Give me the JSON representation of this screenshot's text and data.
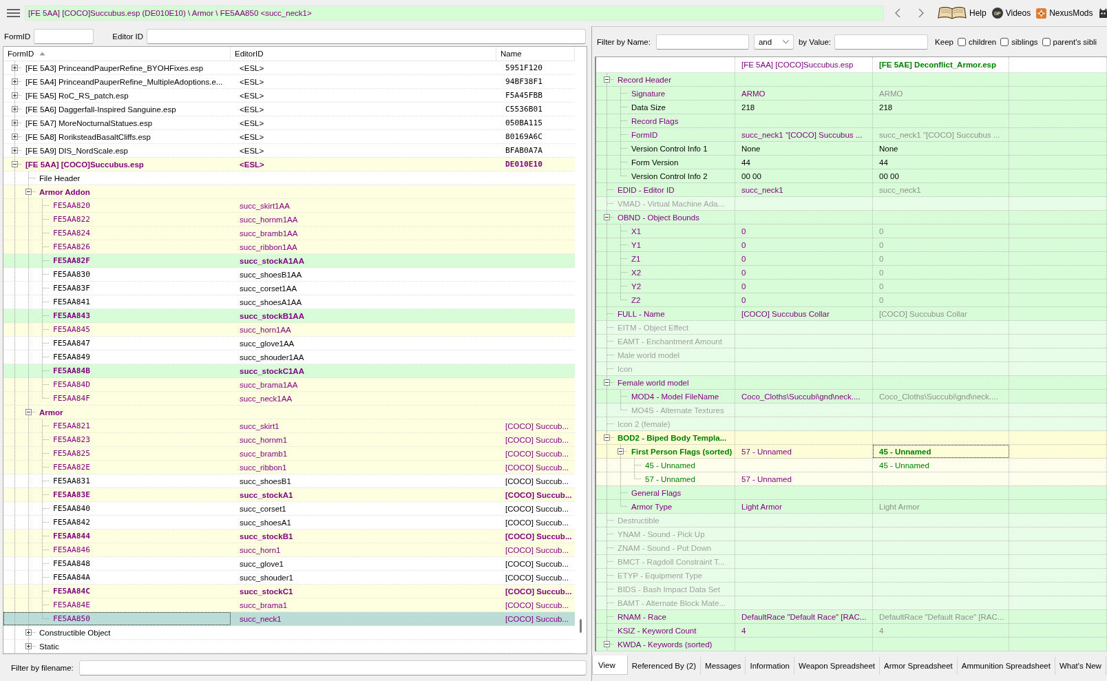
{
  "toolbar": {
    "path": "[FE 5AA] [COCO]Succubus.esp (DE010E10) \\ Armor \\ FE5AA850 <succ_neck1>",
    "links": [
      {
        "kind": "book",
        "label": "Help"
      },
      {
        "kind": "badge",
        "badge": "GP",
        "label": "Videos"
      },
      {
        "kind": "burst",
        "label": "NexusMods"
      },
      {
        "kind": "cat"
      }
    ]
  },
  "navigator": {
    "filters": [
      {
        "label": "FormID"
      },
      {
        "label": "Editor ID"
      }
    ],
    "columns": [
      {
        "label": "FormID",
        "sorted": true
      },
      {
        "label": "EditorID",
        "sorted": false
      },
      {
        "label": "Name",
        "sorted": false
      }
    ],
    "items": [
      {
        "kind": "file",
        "form_id": "[FE 5A3] PrinceandPauperRefine_BYOHFixes.esp",
        "editor_id": "<ESL>",
        "name": "5951F120",
        "modified": false,
        "bold": false,
        "selected": false,
        "expanded": false
      },
      {
        "kind": "file",
        "form_id": "[FE 5A4] PrinceandPauperRefine_MultipleAdoptions.e...",
        "editor_id": "<ESL>",
        "name": "94BF38F1",
        "modified": false,
        "bold": false,
        "selected": false,
        "expanded": false
      },
      {
        "kind": "file",
        "form_id": "[FE 5A5] RoC_RS_patch.esp",
        "editor_id": "<ESL>",
        "name": "F5A45FBB",
        "modified": false,
        "bold": false,
        "selected": false,
        "expanded": false
      },
      {
        "kind": "file",
        "form_id": "[FE 5A6] Daggerfall-Inspired Sanguine.esp",
        "editor_id": "<ESL>",
        "name": "C5536B01",
        "modified": false,
        "bold": false,
        "selected": false,
        "expanded": false
      },
      {
        "kind": "file",
        "form_id": "[FE 5A7] MoreNocturnalStatues.esp",
        "editor_id": "<ESL>",
        "name": "050BA115",
        "modified": false,
        "bold": false,
        "selected": false,
        "expanded": false
      },
      {
        "kind": "file",
        "form_id": "[FE 5A8] RoriksteadBasaltCliffs.esp",
        "editor_id": "<ESL>",
        "name": "80169A6C",
        "modified": false,
        "bold": false,
        "selected": false,
        "expanded": false
      },
      {
        "kind": "file",
        "form_id": "[FE 5A9] DIS_NordScale.esp",
        "editor_id": "<ESL>",
        "name": "BFAB0A7A",
        "modified": false,
        "bold": false,
        "selected": false,
        "expanded": false
      },
      {
        "kind": "file",
        "form_id": "[FE 5AA] [COCO]Succubus.esp",
        "editor_id": "<ESL>",
        "name": "DE010E10",
        "color": "#fefee0",
        "modified": true,
        "bold": true,
        "selected": false,
        "expanded": true,
        "children": [
          {
            "kind": "group",
            "form_id": "File Header",
            "modified": false,
            "bold": false,
            "selected": false
          },
          {
            "kind": "group",
            "form_id": "Armor Addon",
            "color": "#fefee0",
            "modified": true,
            "bold": true,
            "selected": false,
            "expanded": true,
            "children": [
              {
                "kind": "record",
                "form_id": "FE5AA820",
                "editor_id": "succ_skirt1AA",
                "color": "#fefee0",
                "modified": true,
                "bold": false,
                "selected": false
              },
              {
                "kind": "record",
                "form_id": "FE5AA822",
                "editor_id": "succ_hornm1AA",
                "color": "#fefee0",
                "modified": true,
                "bold": false,
                "selected": false
              },
              {
                "kind": "record",
                "form_id": "FE5AA824",
                "editor_id": "succ_bramb1AA",
                "color": "#fefee0",
                "modified": true,
                "bold": false,
                "selected": false
              },
              {
                "kind": "record",
                "form_id": "FE5AA826",
                "editor_id": "succ_ribbon1AA",
                "color": "#fefee0",
                "modified": true,
                "bold": false,
                "selected": false
              },
              {
                "kind": "record",
                "form_id": "FE5AA82F",
                "editor_id": "succ_stockA1AA",
                "color": "#d8fcd8",
                "modified": true,
                "bold": true,
                "selected": false
              },
              {
                "kind": "record",
                "form_id": "FE5AA830",
                "editor_id": "succ_shoesB1AA",
                "modified": false,
                "bold": false,
                "selected": false
              },
              {
                "kind": "record",
                "form_id": "FE5AA83F",
                "editor_id": "succ_corset1AA",
                "modified": false,
                "bold": false,
                "selected": false
              },
              {
                "kind": "record",
                "form_id": "FE5AA841",
                "editor_id": "succ_shoesA1AA",
                "modified": false,
                "bold": false,
                "selected": false
              },
              {
                "kind": "record",
                "form_id": "FE5AA843",
                "editor_id": "succ_stockB1AA",
                "color": "#d8fcd8",
                "modified": true,
                "bold": true,
                "selected": false
              },
              {
                "kind": "record",
                "form_id": "FE5AA845",
                "editor_id": "succ_horn1AA",
                "color": "#fefee0",
                "modified": true,
                "bold": false,
                "selected": false
              },
              {
                "kind": "record",
                "form_id": "FE5AA847",
                "editor_id": "succ_glove1AA",
                "modified": false,
                "bold": false,
                "selected": false
              },
              {
                "kind": "record",
                "form_id": "FE5AA849",
                "editor_id": "succ_shouder1AA",
                "modified": false,
                "bold": false,
                "selected": false
              },
              {
                "kind": "record",
                "form_id": "FE5AA84B",
                "editor_id": "succ_stockC1AA",
                "color": "#d8fcd8",
                "modified": true,
                "bold": true,
                "selected": false
              },
              {
                "kind": "record",
                "form_id": "FE5AA84D",
                "editor_id": "succ_brama1AA",
                "color": "#fefee0",
                "modified": true,
                "bold": false,
                "selected": false
              },
              {
                "kind": "record",
                "form_id": "FE5AA84F",
                "editor_id": "succ_neck1AA",
                "color": "#fefee0",
                "modified": true,
                "bold": false,
                "selected": false
              }
            ]
          },
          {
            "kind": "group",
            "form_id": "Armor",
            "color": "#fefee0",
            "modified": true,
            "bold": true,
            "selected": false,
            "expanded": true,
            "children": [
              {
                "kind": "record",
                "form_id": "FE5AA821",
                "editor_id": "succ_skirt1",
                "name": "[COCO] Succub...",
                "color": "#fefee0",
                "modified": true,
                "bold": false,
                "selected": false
              },
              {
                "kind": "record",
                "form_id": "FE5AA823",
                "editor_id": "succ_hornm1",
                "name": "[COCO] Succub...",
                "color": "#fefee0",
                "modified": true,
                "bold": false,
                "selected": false
              },
              {
                "kind": "record",
                "form_id": "FE5AA825",
                "editor_id": "succ_bramb1",
                "name": "[COCO] Succub...",
                "color": "#fefee0",
                "modified": true,
                "bold": false,
                "selected": false
              },
              {
                "kind": "record",
                "form_id": "FE5AA82E",
                "editor_id": "succ_ribbon1",
                "name": "[COCO] Succub...",
                "color": "#fefee0",
                "modified": true,
                "bold": false,
                "selected": false
              },
              {
                "kind": "record",
                "form_id": "FE5AA831",
                "editor_id": "succ_shoesB1",
                "name": "[COCO] Succub...",
                "modified": false,
                "bold": false,
                "selected": false
              },
              {
                "kind": "record",
                "form_id": "FE5AA83E",
                "editor_id": "succ_stockA1",
                "name": "[COCO] Succub...",
                "color": "#fefee0",
                "modified": true,
                "bold": true,
                "selected": false
              },
              {
                "kind": "record",
                "form_id": "FE5AA840",
                "editor_id": "succ_corset1",
                "name": "[COCO] Succub...",
                "modified": false,
                "bold": false,
                "selected": false
              },
              {
                "kind": "record",
                "form_id": "FE5AA842",
                "editor_id": "succ_shoesA1",
                "name": "[COCO] Succub...",
                "modified": false,
                "bold": false,
                "selected": false
              },
              {
                "kind": "record",
                "form_id": "FE5AA844",
                "editor_id": "succ_stockB1",
                "name": "[COCO] Succub...",
                "color": "#fefee0",
                "modified": true,
                "bold": true,
                "selected": false
              },
              {
                "kind": "record",
                "form_id": "FE5AA846",
                "editor_id": "succ_horn1",
                "name": "[COCO] Succub...",
                "color": "#fefee0",
                "modified": true,
                "bold": false,
                "selected": false
              },
              {
                "kind": "record",
                "form_id": "FE5AA848",
                "editor_id": "succ_glove1",
                "name": "[COCO] Succub...",
                "modified": false,
                "bold": false,
                "selected": false
              },
              {
                "kind": "record",
                "form_id": "FE5AA84A",
                "editor_id": "succ_shouder1",
                "name": "[COCO] Succub...",
                "modified": false,
                "bold": false,
                "selected": false
              },
              {
                "kind": "record",
                "form_id": "FE5AA84C",
                "editor_id": "succ_stockC1",
                "name": "[COCO] Succub...",
                "color": "#fefee0",
                "modified": true,
                "bold": true,
                "selected": false
              },
              {
                "kind": "record",
                "form_id": "FE5AA84E",
                "editor_id": "succ_brama1",
                "name": "[COCO] Succub...",
                "color": "#fefee0",
                "modified": true,
                "bold": false,
                "selected": false
              },
              {
                "kind": "record",
                "form_id": "FE5AA850",
                "editor_id": "succ_neck1",
                "name": "[COCO] Succub...",
                "modified": true,
                "bold": false,
                "selected": true
              }
            ]
          },
          {
            "kind": "group",
            "form_id": "Constructible Object",
            "modified": false,
            "bold": false,
            "selected": false,
            "expanded": false
          },
          {
            "kind": "group",
            "form_id": "Static",
            "modified": false,
            "bold": false,
            "selected": false,
            "expanded": false
          }
        ]
      }
    ],
    "filename_filter": {
      "label": "Filter by filename:"
    }
  },
  "record_view": {
    "filter": {
      "name_label": "Filter by Name:",
      "operator": "and",
      "value_label": "by Value:",
      "keep_label": "Keep",
      "options": [
        {
          "label": "children",
          "checked": false
        },
        {
          "label": "siblings",
          "checked": false
        },
        {
          "label": "parent's sibli",
          "checked": false
        }
      ]
    },
    "columns": [
      {
        "text": "[FE 5AA] [COCO]Succubus.esp",
        "kind": "master",
        "bold": false
      },
      {
        "text": "[FE 5AE] Deconflict_Armor.esp",
        "kind": "winner",
        "bold": true
      }
    ],
    "rows": [
      {
        "label": "Record Header",
        "kind": "override",
        "bold": false,
        "expanded": true,
        "children": [
          {
            "label": "Signature",
            "kind": "override",
            "bold": false,
            "cells": [
              {
                "text": "ARMO",
                "kind": "master",
                "bold": false,
                "selected": false
              },
              {
                "text": "ARMO",
                "kind": "copy",
                "bold": false,
                "selected": false
              }
            ]
          },
          {
            "label": "Data Size",
            "kind": "identical",
            "bold": false,
            "cells": [
              {
                "text": "218",
                "kind": "plain",
                "bold": false,
                "selected": false
              },
              {
                "text": "218",
                "kind": "plain",
                "bold": false,
                "selected": false
              }
            ]
          },
          {
            "label": "Record Flags",
            "kind": "override",
            "bold": false
          },
          {
            "label": "FormID",
            "kind": "override",
            "bold": false,
            "cells": [
              {
                "text": "succ_neck1 \"[COCO] Succubus ...",
                "kind": "master",
                "bold": false,
                "selected": false
              },
              {
                "text": "succ_neck1 \"[COCO] Succubus ...",
                "kind": "copy",
                "bold": false,
                "selected": false
              }
            ]
          },
          {
            "label": "Version Control Info 1",
            "kind": "identical",
            "bold": false,
            "cells": [
              {
                "text": "None",
                "kind": "plain",
                "bold": false,
                "selected": false
              },
              {
                "text": "None",
                "kind": "plain",
                "bold": false,
                "selected": false
              }
            ]
          },
          {
            "label": "Form Version",
            "kind": "identical",
            "bold": false,
            "cells": [
              {
                "text": "44",
                "kind": "plain",
                "bold": false,
                "selected": false
              },
              {
                "text": "44",
                "kind": "plain",
                "bold": false,
                "selected": false
              }
            ]
          },
          {
            "label": "Version Control Info 2",
            "kind": "identical",
            "bold": false,
            "cells": [
              {
                "text": "00 00",
                "kind": "plain",
                "bold": false,
                "selected": false
              },
              {
                "text": "00 00",
                "kind": "plain",
                "bold": false,
                "selected": false
              }
            ]
          }
        ]
      },
      {
        "label": "EDID - Editor ID",
        "kind": "override",
        "bold": false,
        "cells": [
          {
            "text": "succ_neck1",
            "kind": "master",
            "bold": false,
            "selected": false
          },
          {
            "text": "succ_neck1",
            "kind": "copy",
            "bold": false,
            "selected": false
          }
        ]
      },
      {
        "label": "VMAD - Virtual Machine Ada...",
        "kind": "empty",
        "bold": false
      },
      {
        "label": "OBND - Object Bounds",
        "kind": "override",
        "bold": false,
        "expanded": true,
        "children": [
          {
            "label": "X1",
            "kind": "override",
            "bold": false,
            "cells": [
              {
                "text": "0",
                "kind": "master",
                "bold": false,
                "selected": false
              },
              {
                "text": "0",
                "kind": "copy",
                "bold": false,
                "selected": false
              }
            ]
          },
          {
            "label": "Y1",
            "kind": "override",
            "bold": false,
            "cells": [
              {
                "text": "0",
                "kind": "master",
                "bold": false,
                "selected": false
              },
              {
                "text": "0",
                "kind": "copy",
                "bold": false,
                "selected": false
              }
            ]
          },
          {
            "label": "Z1",
            "kind": "override",
            "bold": false,
            "cells": [
              {
                "text": "0",
                "kind": "master",
                "bold": false,
                "selected": false
              },
              {
                "text": "0",
                "kind": "copy",
                "bold": false,
                "selected": false
              }
            ]
          },
          {
            "label": "X2",
            "kind": "override",
            "bold": false,
            "cells": [
              {
                "text": "0",
                "kind": "master",
                "bold": false,
                "selected": false
              },
              {
                "text": "0",
                "kind": "copy",
                "bold": false,
                "selected": false
              }
            ]
          },
          {
            "label": "Y2",
            "kind": "override",
            "bold": false,
            "cells": [
              {
                "text": "0",
                "kind": "master",
                "bold": false,
                "selected": false
              },
              {
                "text": "0",
                "kind": "copy",
                "bold": false,
                "selected": false
              }
            ]
          },
          {
            "label": "Z2",
            "kind": "override",
            "bold": false,
            "cells": [
              {
                "text": "0",
                "kind": "master",
                "bold": false,
                "selected": false
              },
              {
                "text": "0",
                "kind": "copy",
                "bold": false,
                "selected": false
              }
            ]
          }
        ]
      },
      {
        "label": "FULL - Name",
        "kind": "override",
        "bold": false,
        "cells": [
          {
            "text": "[COCO] Succubus Collar",
            "kind": "master",
            "bold": false,
            "selected": false
          },
          {
            "text": "[COCO] Succubus Collar",
            "kind": "copy",
            "bold": false,
            "selected": false
          }
        ]
      },
      {
        "label": "EITM - Object Effect",
        "kind": "empty",
        "bold": false
      },
      {
        "label": "EAMT - Enchantment Amount",
        "kind": "empty",
        "bold": false
      },
      {
        "label": "Male world model",
        "kind": "empty",
        "bold": false
      },
      {
        "label": "Icon",
        "kind": "empty",
        "bold": false
      },
      {
        "label": "Female world model",
        "kind": "override",
        "bold": false,
        "expanded": true,
        "children": [
          {
            "label": "MOD4 - Model FileName",
            "kind": "override",
            "bold": false,
            "cells": [
              {
                "text": "Coco_Cloths\\Succubi\\gnd\\neck....",
                "kind": "master",
                "bold": false,
                "selected": false
              },
              {
                "text": "Coco_Cloths\\Succubi\\gnd\\neck....",
                "kind": "copy",
                "bold": false,
                "selected": false
              }
            ]
          },
          {
            "label": "MO4S - Alternate Textures",
            "kind": "empty",
            "bold": false
          }
        ]
      },
      {
        "label": "Icon 2 (female)",
        "kind": "empty",
        "bold": false
      },
      {
        "label": "BOD2 - Biped Body Templa...",
        "kind": "conflict",
        "bold": true,
        "expanded": true,
        "children": [
          {
            "label": "First Person Flags (sorted)",
            "kind": "conflict",
            "bold": true,
            "expanded": true,
            "cells": [
              {
                "text": "57 - Unnamed",
                "kind": "master",
                "bold": false,
                "selected": false
              },
              {
                "text": "45 - Unnamed",
                "kind": "winner",
                "bold": true,
                "selected": true
              }
            ],
            "children": [
              {
                "label": "45 - Unnamed",
                "kind": "subconflict",
                "bold": false,
                "cells": [
                  null,
                  {
                    "text": "45 - Unnamed",
                    "kind": "winner",
                    "bold": false,
                    "selected": false
                  }
                ]
              },
              {
                "label": "57 - Unnamed",
                "kind": "subconflict",
                "bold": false,
                "cells": [
                  {
                    "text": "57 - Unnamed",
                    "kind": "master",
                    "bold": false,
                    "selected": false
                  },
                  null
                ]
              }
            ]
          },
          {
            "label": "General Flags",
            "kind": "override",
            "bold": false
          },
          {
            "label": "Armor Type",
            "kind": "override",
            "bold": false,
            "cells": [
              {
                "text": "Light Armor",
                "kind": "master",
                "bold": false,
                "selected": false
              },
              {
                "text": "Light Armor",
                "kind": "copy",
                "bold": false,
                "selected": false
              }
            ]
          }
        ]
      },
      {
        "label": "Destructible",
        "kind": "empty",
        "bold": false
      },
      {
        "label": "YNAM - Sound - Pick Up",
        "kind": "empty",
        "bold": false
      },
      {
        "label": "ZNAM - Sound - Put Down",
        "kind": "empty",
        "bold": false
      },
      {
        "label": "BMCT - Ragdoll Constraint T...",
        "kind": "empty",
        "bold": false
      },
      {
        "label": "ETYP - Equipment Type",
        "kind": "empty",
        "bold": false
      },
      {
        "label": "BIDS - Bash Impact Data Set",
        "kind": "empty",
        "bold": false
      },
      {
        "label": "BAMT - Alternate Block Mate...",
        "kind": "empty",
        "bold": false
      },
      {
        "label": "RNAM - Race",
        "kind": "override",
        "bold": false,
        "cells": [
          {
            "text": "DefaultRace \"Default Race\" [RAC...",
            "kind": "master",
            "bold": false,
            "selected": false
          },
          {
            "text": "DefaultRace \"Default Race\" [RAC...",
            "kind": "copy",
            "bold": false,
            "selected": false
          }
        ]
      },
      {
        "label": "KSIZ - Keyword Count",
        "kind": "override",
        "bold": false,
        "cells": [
          {
            "text": "4",
            "kind": "master",
            "bold": false,
            "selected": false
          },
          {
            "text": "4",
            "kind": "copy",
            "bold": false,
            "selected": false
          }
        ]
      },
      {
        "label": "KWDA - Keywords (sorted)",
        "kind": "override",
        "bold": false,
        "expanded": true
      }
    ],
    "tabs": [
      {
        "label": "View",
        "selected": true
      },
      {
        "label": "Referenced By (2)",
        "selected": false
      },
      {
        "label": "Messages",
        "selected": false
      },
      {
        "label": "Information",
        "selected": false
      },
      {
        "label": "Weapon Spreadsheet",
        "selected": false
      },
      {
        "label": "Armor Spreadsheet",
        "selected": false
      },
      {
        "label": "Ammunition Spreadsheet",
        "selected": false
      },
      {
        "label": "What's New",
        "selected": false
      }
    ]
  }
}
